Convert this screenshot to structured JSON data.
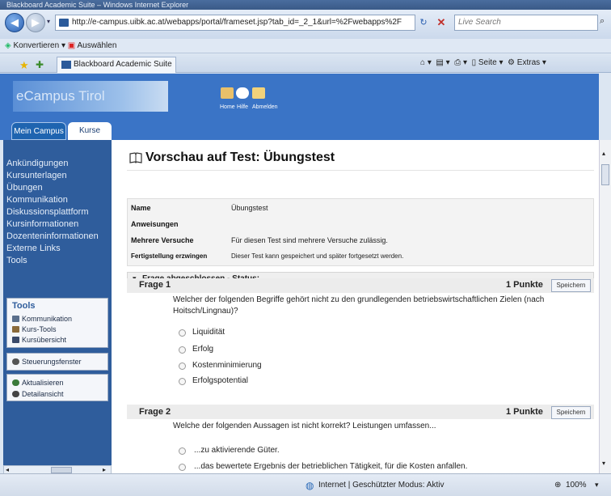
{
  "window": {
    "title": "Blackboard Academic Suite – Windows Internet Explorer"
  },
  "addressbar": {
    "url": "http://e-campus.uibk.ac.at/webapps/portal/frameset.jsp?tab_id=_2_1&url=%2Fwebapps%2F",
    "search_placeholder": "Live Search"
  },
  "linksbar": {
    "convert": "Konvertieren",
    "select": "Auswählen"
  },
  "browser_tab": {
    "label": "Blackboard Academic Suite"
  },
  "toolbar": {
    "page": "Seite",
    "extras": "Extras"
  },
  "header": {
    "logo": "eCampus Tirol",
    "icons": [
      {
        "label": "Home"
      },
      {
        "label": "Hilfe"
      },
      {
        "label": "Abmelden"
      }
    ]
  },
  "tabs": [
    {
      "label": "Mein Campus"
    },
    {
      "label": "Kurse"
    }
  ],
  "sidebar": {
    "items": [
      "Ankündigungen",
      "Kursunterlagen",
      "Übungen",
      "Kommunikation",
      "Diskussionsplattform",
      "Kursinformationen",
      "Dozenteninformationen",
      "Externe Links",
      "Tools"
    ],
    "tools_heading": "Tools",
    "tools": [
      "Kommunikation",
      "Kurs-Tools",
      "Kursübersicht"
    ],
    "control_panel": "Steuerungsfenster",
    "refresh": "Aktualisieren",
    "detail": "Detailansicht"
  },
  "page": {
    "title": "Vorschau auf Test: Übungstest",
    "info": [
      {
        "key": "Name",
        "value": "Übungstest"
      },
      {
        "key": "Anweisungen",
        "value": ""
      },
      {
        "key": "Mehrere Versuche",
        "value": "Für diesen Test sind mehrere Versuche zulässig."
      },
      {
        "key": "Fertigstellung erzwingen",
        "value": "Dieser Test kann gespeichert und später fortgesetzt werden."
      }
    ],
    "status": "Frage abgeschlossen - Status:",
    "questions": [
      {
        "label": "Frage 1",
        "points": "1 Punkte",
        "save": "Speichern",
        "text": "Welcher der folgenden Begriffe gehört nicht zu den grundlegenden betriebswirtschaftlichen Zielen (nach Hoitsch/Lingnau)?",
        "options": [
          "Liquidität",
          "Erfolg",
          "Kostenminimierung",
          "Erfolgspotential"
        ]
      },
      {
        "label": "Frage 2",
        "points": "1 Punkte",
        "save": "Speichern",
        "text": "Welche der folgenden Aussagen ist nicht korrekt? Leistungen umfassen...",
        "options": [
          "...zu aktivierende Güter.",
          "...das bewertete Ergebnis der betrieblichen Tätigkeit, für die Kosten anfallen."
        ]
      }
    ]
  },
  "statusbar": {
    "zone": "Internet | Geschützter Modus: Aktiv",
    "zoom": "100%"
  }
}
